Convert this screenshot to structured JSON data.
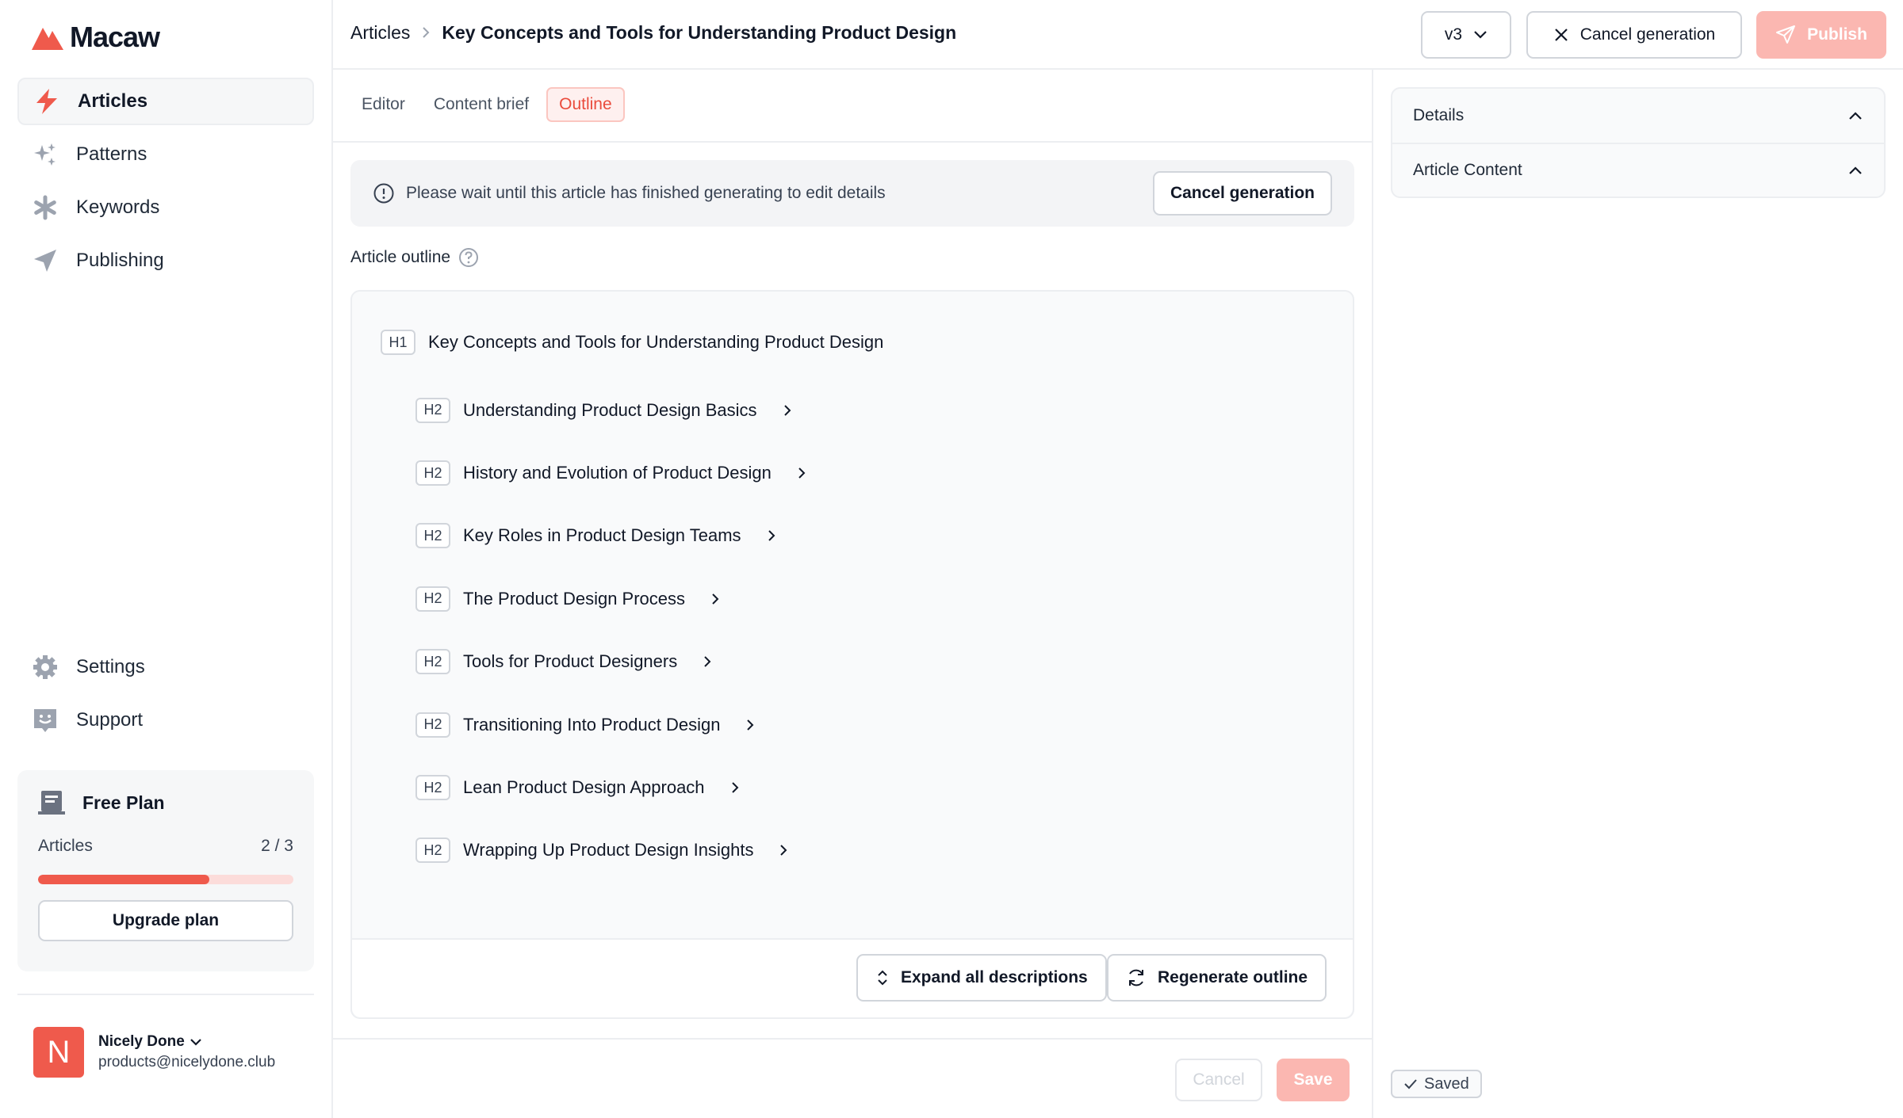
{
  "app": {
    "name": "Macaw",
    "brand_color": "#ef5a4c"
  },
  "sidebar": {
    "items": [
      {
        "label": "Articles",
        "icon": "bolt-icon",
        "active": true
      },
      {
        "label": "Patterns",
        "icon": "sparkles-icon"
      },
      {
        "label": "Keywords",
        "icon": "asterisk-icon"
      },
      {
        "label": "Publishing",
        "icon": "send-icon"
      }
    ],
    "bottom_items": [
      {
        "label": "Settings",
        "icon": "gear-icon"
      },
      {
        "label": "Support",
        "icon": "support-icon"
      }
    ],
    "plan": {
      "name": "Free Plan",
      "usage_label": "Articles",
      "usage_text": "2 / 3",
      "usage_fraction": 0.67,
      "upgrade_label": "Upgrade plan"
    },
    "user": {
      "initial": "N",
      "name": "Nicely Done",
      "email": "products@nicelydone.club"
    }
  },
  "header": {
    "breadcrumb_root": "Articles",
    "breadcrumb_current": "Key Concepts and Tools for Understanding Product Design",
    "version": "v3",
    "cancel_generation_label": "Cancel generation",
    "publish_label": "Publish"
  },
  "tabs": [
    {
      "label": "Editor"
    },
    {
      "label": "Content brief"
    },
    {
      "label": "Outline",
      "active": true
    }
  ],
  "notice": {
    "text": "Please wait until this article has finished generating to edit details",
    "button_label": "Cancel generation"
  },
  "outline": {
    "label": "Article outline",
    "h1": {
      "tag": "H1",
      "text": "Key Concepts and Tools for Understanding Product Design"
    },
    "h2": [
      {
        "tag": "H2",
        "text": "Understanding Product Design Basics"
      },
      {
        "tag": "H2",
        "text": "History and Evolution of Product Design"
      },
      {
        "tag": "H2",
        "text": "Key Roles in Product Design Teams"
      },
      {
        "tag": "H2",
        "text": "The Product Design Process"
      },
      {
        "tag": "H2",
        "text": "Tools for Product Designers"
      },
      {
        "tag": "H2",
        "text": "Transitioning Into Product Design"
      },
      {
        "tag": "H2",
        "text": "Lean Product Design Approach"
      },
      {
        "tag": "H2",
        "text": "Wrapping Up Product Design Insights"
      }
    ],
    "expand_label": "Expand all descriptions",
    "regenerate_label": "Regenerate outline"
  },
  "form_actions": {
    "cancel_label": "Cancel",
    "save_label": "Save"
  },
  "right_panel": {
    "sections": [
      {
        "label": "Details"
      },
      {
        "label": "Article Content"
      }
    ],
    "saved_label": "Saved"
  }
}
